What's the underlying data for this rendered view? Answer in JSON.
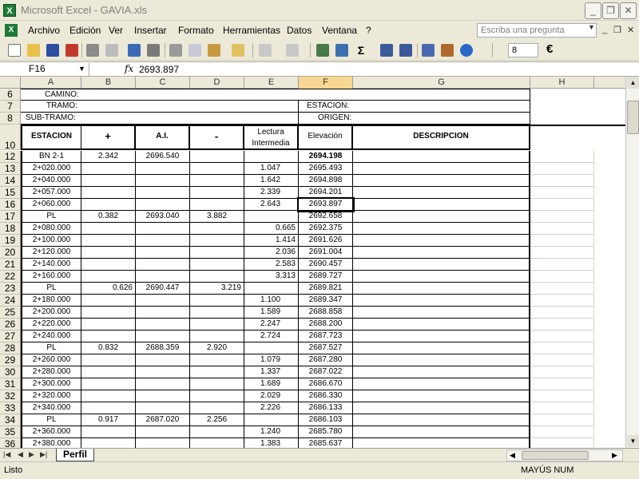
{
  "titlebar": {
    "title": "Microsoft Excel - GAVIA.xls",
    "app_icon": "X"
  },
  "menu": {
    "items": [
      "Archivo",
      "Edición",
      "Ver",
      "Insertar",
      "Formato",
      "Herramientas",
      "Datos",
      "Ventana",
      "?"
    ],
    "ask_placeholder": "Escriba una pregunta"
  },
  "toolbar": {
    "font_size": "8",
    "euro": "€"
  },
  "formula_bar": {
    "name_box": "F16",
    "fx": "fx",
    "formula": "2693.897"
  },
  "columns": [
    "A",
    "B",
    "C",
    "D",
    "E",
    "F",
    "G",
    "H"
  ],
  "header_rows": {
    "r6": {
      "num": "6",
      "camino": "CAMINO:"
    },
    "r7": {
      "num": "7",
      "tramo": "TRAMO:",
      "estacion": "ESTACION:"
    },
    "r8": {
      "num": "8",
      "subtramo": "SUB-TRAMO:",
      "origen": "ORIGEN:"
    },
    "r10": {
      "num": "10",
      "estacion": "ESTACION",
      "plus": "+",
      "ai": "A.I.",
      "minus": "-",
      "lectura": "Lectura Intermedia",
      "elevacion": "Elevación",
      "descripcion": "DESCRIPCION"
    }
  },
  "rows": [
    {
      "n": "12",
      "a": "BN 2-1",
      "b": "2.342",
      "c": "2696.540",
      "d": "",
      "e": "",
      "f": "2694.198"
    },
    {
      "n": "13",
      "a": "2+020.000",
      "b": "",
      "c": "",
      "d": "",
      "e": "1.047",
      "f": "2695.493"
    },
    {
      "n": "14",
      "a": "2+040.000",
      "b": "",
      "c": "",
      "d": "",
      "e": "1.642",
      "f": "2694.898"
    },
    {
      "n": "15",
      "a": "2+057.000",
      "b": "",
      "c": "",
      "d": "",
      "e": "2.339",
      "f": "2694.201"
    },
    {
      "n": "16",
      "a": "2+060.000",
      "b": "",
      "c": "",
      "d": "",
      "e": "2.643",
      "f": "2693.897"
    },
    {
      "n": "17",
      "a": "PL",
      "b": "0.382",
      "c": "2693.040",
      "d": "3.882",
      "e": "",
      "f": "2692.658"
    },
    {
      "n": "18",
      "a": "2+080.000",
      "b": "",
      "c": "",
      "d": "",
      "e": "0.665",
      "f": "2692.375"
    },
    {
      "n": "19",
      "a": "2+100.000",
      "b": "",
      "c": "",
      "d": "",
      "e": "1.414",
      "f": "2691.626"
    },
    {
      "n": "20",
      "a": "2+120.000",
      "b": "",
      "c": "",
      "d": "",
      "e": "2.036",
      "f": "2691.004"
    },
    {
      "n": "21",
      "a": "2+140.000",
      "b": "",
      "c": "",
      "d": "",
      "e": "2.583",
      "f": "2690.457"
    },
    {
      "n": "22",
      "a": "2+160.000",
      "b": "",
      "c": "",
      "d": "",
      "e": "3.313",
      "f": "2689.727"
    },
    {
      "n": "23",
      "a": "PL",
      "b": "0.626",
      "c": "2690.447",
      "d": "3.219",
      "e": "",
      "f": "2689.821"
    },
    {
      "n": "24",
      "a": "2+180.000",
      "b": "",
      "c": "",
      "d": "",
      "e": "1.100",
      "f": "2689.347"
    },
    {
      "n": "25",
      "a": "2+200.000",
      "b": "",
      "c": "",
      "d": "",
      "e": "1.589",
      "f": "2688.858"
    },
    {
      "n": "26",
      "a": "2+220.000",
      "b": "",
      "c": "",
      "d": "",
      "e": "2.247",
      "f": "2688.200"
    },
    {
      "n": "27",
      "a": "2+240.000",
      "b": "",
      "c": "",
      "d": "",
      "e": "2.724",
      "f": "2687.723"
    },
    {
      "n": "28",
      "a": "PL",
      "b": "0.832",
      "c": "2688.359",
      "d": "2.920",
      "e": "",
      "f": "2687.527"
    },
    {
      "n": "29",
      "a": "2+260.000",
      "b": "",
      "c": "",
      "d": "",
      "e": "1.079",
      "f": "2687.280"
    },
    {
      "n": "30",
      "a": "2+280.000",
      "b": "",
      "c": "",
      "d": "",
      "e": "1.337",
      "f": "2687.022"
    },
    {
      "n": "31",
      "a": "2+300.000",
      "b": "",
      "c": "",
      "d": "",
      "e": "1.689",
      "f": "2686.670"
    },
    {
      "n": "32",
      "a": "2+320.000",
      "b": "",
      "c": "",
      "d": "",
      "e": "2.029",
      "f": "2686.330"
    },
    {
      "n": "33",
      "a": "2+340.000",
      "b": "",
      "c": "",
      "d": "",
      "e": "2.226",
      "f": "2686.133"
    },
    {
      "n": "34",
      "a": "PL",
      "b": "0.917",
      "c": "2687.020",
      "d": "2.256",
      "e": "",
      "f": "2686.103"
    },
    {
      "n": "35",
      "a": "2+360.000",
      "b": "",
      "c": "",
      "d": "",
      "e": "1.240",
      "f": "2685.780"
    },
    {
      "n": "36",
      "a": "2+380.000",
      "b": "",
      "c": "",
      "d": "",
      "e": "1.383",
      "f": "2685.637"
    }
  ],
  "sheet_tab": "Perfil",
  "status": {
    "left": "Listo",
    "right": "MAYÚS NUM"
  }
}
